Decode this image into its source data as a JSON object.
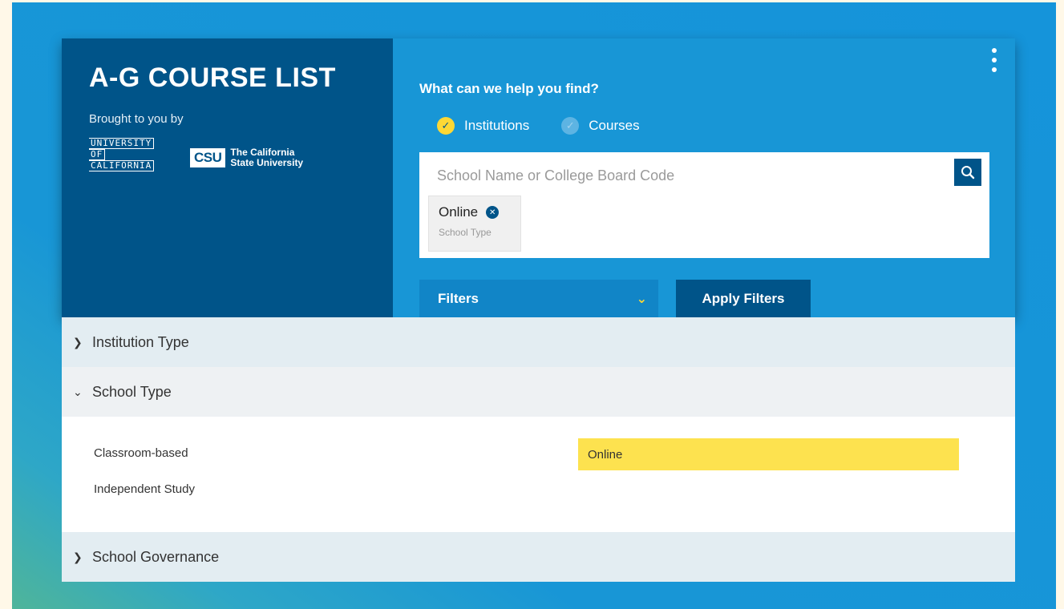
{
  "brand": {
    "title": "A-G COURSE LIST",
    "brought_by": "Brought to you by",
    "uc_logo": [
      "UNIVERSITY",
      "OF",
      "CALIFORNIA"
    ],
    "csu_mark": "CSU",
    "csu_name_line1": "The California",
    "csu_name_line2": "State University"
  },
  "search": {
    "prompt": "What can we help you find?",
    "options": [
      {
        "label": "Institutions",
        "selected": true
      },
      {
        "label": "Courses",
        "selected": false
      }
    ],
    "placeholder": "School Name or College Board Code",
    "value": "",
    "chip": {
      "label": "Online",
      "category": "School Type"
    },
    "filters_label": "Filters",
    "apply_label": "Apply Filters"
  },
  "filters": {
    "sections": [
      {
        "label": "Institution Type",
        "expanded": false
      },
      {
        "label": "School Type",
        "expanded": true
      },
      {
        "label": "School Governance",
        "expanded": false
      }
    ],
    "school_type_options": [
      {
        "label": "Classroom-based",
        "selected": false
      },
      {
        "label": "Independent Study",
        "selected": false
      },
      {
        "label": "Online",
        "selected": true
      }
    ]
  },
  "colors": {
    "brand_dark": "#005489",
    "brand_blue": "#1896d6",
    "highlight": "#fde24f"
  }
}
